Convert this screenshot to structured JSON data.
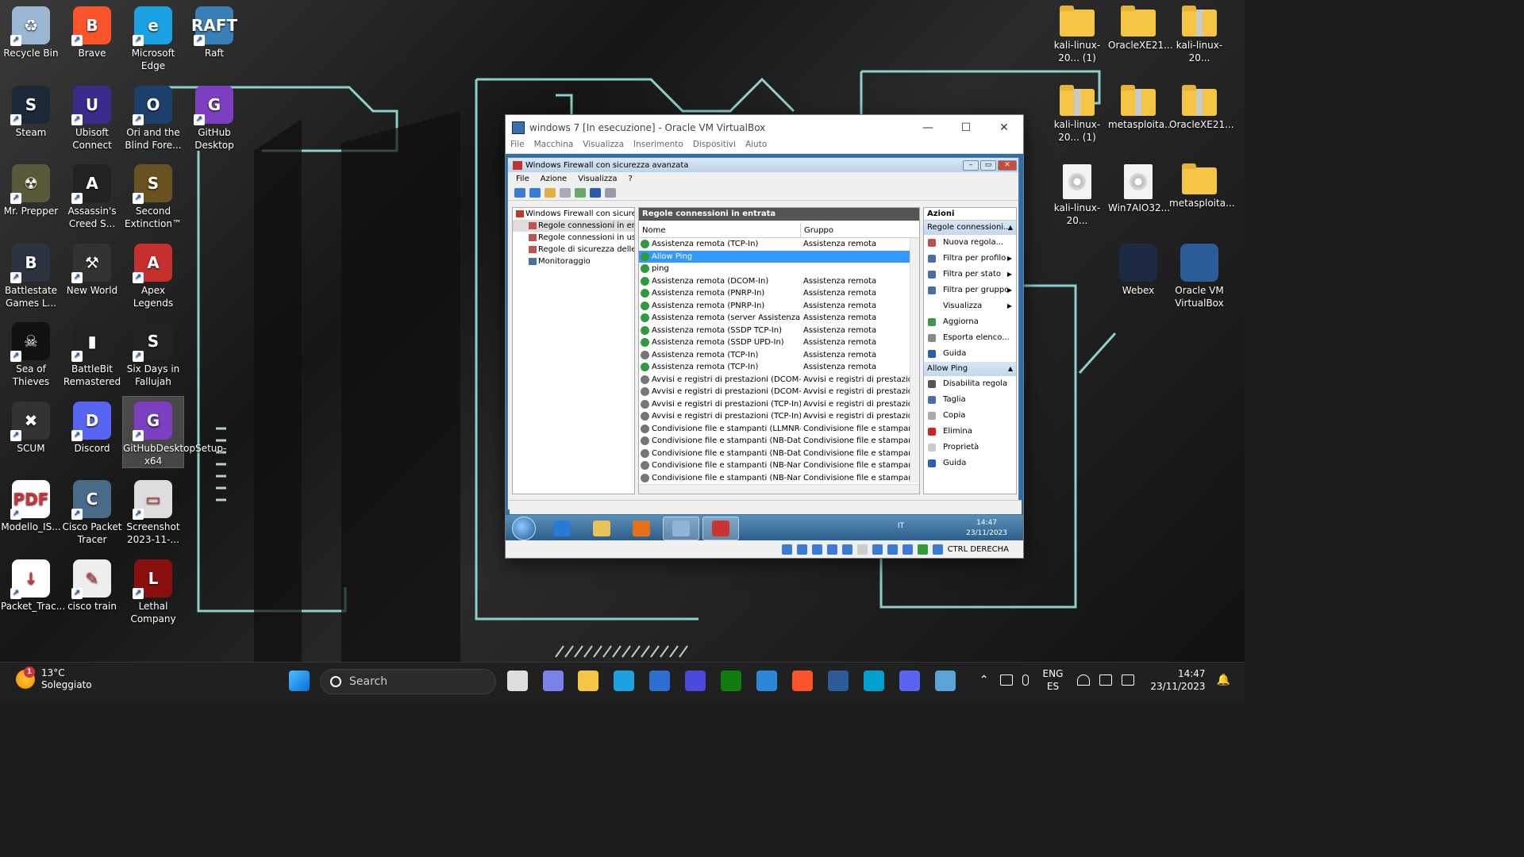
{
  "desktop": {
    "icons_left": [
      {
        "label": "Recycle Bin",
        "color": "#9bb7d4",
        "glyph": "♻"
      },
      {
        "label": "Brave",
        "color": "#fb542b",
        "glyph": "B"
      },
      {
        "label": "Microsoft Edge",
        "color": "#1ba1e2",
        "glyph": "e"
      },
      {
        "label": "Raft",
        "color": "#3a7fb8",
        "glyph": "RAFT"
      },
      {
        "label": "Steam",
        "color": "#1b2838",
        "glyph": "S"
      },
      {
        "label": "Ubisoft Connect",
        "color": "#3b2a8a",
        "glyph": "U"
      },
      {
        "label": "Ori and the Blind Fore...",
        "color": "#1d3f6b",
        "glyph": "O"
      },
      {
        "label": "GitHub Desktop",
        "color": "#7b3fbf",
        "glyph": "G"
      },
      {
        "label": "Mr. Prepper",
        "color": "#5a5a3a",
        "glyph": "☢"
      },
      {
        "label": "Assassin's Creed S...",
        "color": "#222",
        "glyph": "A"
      },
      {
        "label": "Second Extinction™",
        "color": "#6a5220",
        "glyph": "S"
      },
      {
        "label": "Battlestate Games L...",
        "color": "#2b3440",
        "glyph": "B"
      },
      {
        "label": "New World",
        "color": "#333",
        "glyph": "⚒"
      },
      {
        "label": "Apex Legends",
        "color": "#c5302e",
        "glyph": "A"
      },
      {
        "label": "Sea of Thieves",
        "color": "#111",
        "glyph": "☠"
      },
      {
        "label": "BattleBit Remastered",
        "color": "#222",
        "glyph": "▮"
      },
      {
        "label": "Six Days in Fallujah",
        "color": "#222",
        "glyph": "S"
      },
      {
        "label": "SCUM",
        "color": "#333",
        "glyph": "✖"
      },
      {
        "label": "Discord",
        "color": "#5865f2",
        "glyph": "D"
      },
      {
        "label": "GitHubDesktopSetup-x64",
        "color": "#7b3fbf",
        "glyph": "G"
      },
      {
        "label": "Modello_IS...",
        "color": "#fff",
        "glyph": "PDF"
      },
      {
        "label": "Cisco Packet Tracer",
        "color": "#4a6a8a",
        "glyph": "C"
      },
      {
        "label": "Screenshot 2023-11-...",
        "color": "#ddd",
        "glyph": "▭"
      },
      {
        "label": "Packet_Trac...",
        "color": "#fff",
        "glyph": "↓"
      },
      {
        "label": "cisco train",
        "color": "#eee",
        "glyph": "✎"
      },
      {
        "label": "Lethal Company",
        "color": "#8a1010",
        "glyph": "L"
      }
    ],
    "icons_right": [
      {
        "label": "kali-linux-20... (1)",
        "type": "folder"
      },
      {
        "label": "OracleXE21...",
        "type": "folder"
      },
      {
        "label": "kali-linux-20...",
        "type": "zip"
      },
      {
        "label": "kali-linux-20... (1)",
        "type": "zip"
      },
      {
        "label": "metasploita...",
        "type": "zip"
      },
      {
        "label": "OracleXE21...",
        "type": "zip"
      },
      {
        "label": "kali-linux-20...",
        "type": "disc"
      },
      {
        "label": "Win7AIO32...",
        "type": "disc"
      },
      {
        "label": "metasploita...",
        "type": "folder"
      },
      {
        "label": "Webex",
        "type": "app",
        "color": "#1c2a44"
      },
      {
        "label": "Oracle VM VirtualBox",
        "type": "app",
        "color": "#2a5c9a"
      }
    ]
  },
  "vbox": {
    "title": "windows 7 [In esecuzione] - Oracle VM VirtualBox",
    "menu": [
      "File",
      "Macchina",
      "Visualizza",
      "Inserimento",
      "Dispositivi",
      "Aiuto"
    ],
    "minimize": "—",
    "maximize": "☐",
    "close": "✕",
    "host_key": "CTRL DERECHA"
  },
  "firewall": {
    "title": "Windows Firewall con sicurezza avanzata",
    "menu": [
      "File",
      "Azione",
      "Visualizza",
      "?"
    ],
    "tree": [
      {
        "label": "Windows Firewall con sicurezza",
        "indent": 0
      },
      {
        "label": "Regole connessioni in entrata",
        "indent": 1,
        "selected": true
      },
      {
        "label": "Regole connessioni in uscita",
        "indent": 1
      },
      {
        "label": "Regole di sicurezza delle connessioni",
        "indent": 1
      },
      {
        "label": "Monitoraggio",
        "indent": 1
      }
    ],
    "panel_title": "Regole connessioni in entrata",
    "col_name": "Nome",
    "col_group": "Gruppo",
    "rows": [
      {
        "name": "Assistenza remota (TCP-In)",
        "group": "Assistenza remota",
        "enabled": true
      },
      {
        "name": "Allow Ping",
        "group": "",
        "enabled": true,
        "selected": true
      },
      {
        "name": "ping",
        "group": "",
        "enabled": true
      },
      {
        "name": "Assistenza remota (DCOM-In)",
        "group": "Assistenza remota",
        "enabled": true
      },
      {
        "name": "Assistenza remota (PNRP-In)",
        "group": "Assistenza remota",
        "enabled": true
      },
      {
        "name": "Assistenza remota (PNRP-In)",
        "group": "Assistenza remota",
        "enabled": true
      },
      {
        "name": "Assistenza remota (server Assistenza rem...",
        "group": "Assistenza remota",
        "enabled": true
      },
      {
        "name": "Assistenza remota (SSDP TCP-In)",
        "group": "Assistenza remota",
        "enabled": true
      },
      {
        "name": "Assistenza remota (SSDP UPD-In)",
        "group": "Assistenza remota",
        "enabled": true
      },
      {
        "name": "Assistenza remota (TCP-In)",
        "group": "Assistenza remota",
        "enabled": false
      },
      {
        "name": "Assistenza remota (TCP-In)",
        "group": "Assistenza remota",
        "enabled": true
      },
      {
        "name": "Avvisi e registri di prestazioni (DCOM-In)",
        "group": "Avvisi e registri di prestazioni",
        "enabled": false
      },
      {
        "name": "Avvisi e registri di prestazioni (DCOM-In)",
        "group": "Avvisi e registri di prestazioni",
        "enabled": false
      },
      {
        "name": "Avvisi e registri di prestazioni (TCP-In)",
        "group": "Avvisi e registri di prestazioni",
        "enabled": false
      },
      {
        "name": "Avvisi e registri di prestazioni (TCP-In)",
        "group": "Avvisi e registri di prestazioni",
        "enabled": false
      },
      {
        "name": "Condivisione file e stampanti (LLMNR-U...",
        "group": "Condivisione file e stampanti",
        "enabled": false
      },
      {
        "name": "Condivisione file e stampanti (NB-Datagr...",
        "group": "Condivisione file e stampanti",
        "enabled": false
      },
      {
        "name": "Condivisione file e stampanti (NB-Datagr...",
        "group": "Condivisione file e stampanti",
        "enabled": false
      },
      {
        "name": "Condivisione file e stampanti (NB-Name...",
        "group": "Condivisione file e stampanti",
        "enabled": false
      },
      {
        "name": "Condivisione file e stampanti (NB-Name...",
        "group": "Condivisione file e stampanti",
        "enabled": false
      }
    ],
    "actions_title": "Azioni",
    "section1": "Regole connessioni...",
    "actions1": [
      {
        "label": "Nuova regola...",
        "color": "#c0504d",
        "sub": false
      },
      {
        "label": "Filtra per profilo",
        "color": "#4a6fa5",
        "sub": true
      },
      {
        "label": "Filtra per stato",
        "color": "#4a6fa5",
        "sub": true
      },
      {
        "label": "Filtra per gruppo",
        "color": "#4a6fa5",
        "sub": true
      },
      {
        "label": "Visualizza",
        "color": "transparent",
        "sub": true
      },
      {
        "label": "Aggiorna",
        "color": "#3c9a4a",
        "sub": false
      },
      {
        "label": "Esporta elenco...",
        "color": "#888",
        "sub": false
      },
      {
        "label": "Guida",
        "color": "#2a5db0",
        "sub": false
      }
    ],
    "section2": "Allow Ping",
    "actions2": [
      {
        "label": "Disabilita regola",
        "color": "#555"
      },
      {
        "label": "Taglia",
        "color": "#4a6fa5"
      },
      {
        "label": "Copia",
        "color": "#aaa"
      },
      {
        "label": "Elimina",
        "color": "#d12020"
      },
      {
        "label": "Proprietà",
        "color": "#ccc"
      },
      {
        "label": "Guida",
        "color": "#2a5db0"
      }
    ]
  },
  "guest_taskbar": {
    "lang": "IT",
    "time": "14:47",
    "date": "23/11/2023"
  },
  "taskbar": {
    "weather_temp": "13°C",
    "weather_desc": "Soleggiato",
    "weather_badge": "1",
    "search_placeholder": "Search",
    "lang": "ENG",
    "region": "ES",
    "time": "14:47",
    "date": "23/11/2023",
    "apps": [
      {
        "name": "start-button",
        "color": "#3b8ee8"
      },
      {
        "name": "task-view",
        "color": "#ddd"
      },
      {
        "name": "teams-chat",
        "color": "#7b83eb"
      },
      {
        "name": "file-explorer",
        "color": "#f6c544"
      },
      {
        "name": "edge",
        "color": "#1ba1e2"
      },
      {
        "name": "microsoft-store",
        "color": "#2c6fd1"
      },
      {
        "name": "vs-app",
        "color": "#4a4adf"
      },
      {
        "name": "xbox",
        "color": "#107c10"
      },
      {
        "name": "mail",
        "color": "#2b88d8"
      },
      {
        "name": "brave",
        "color": "#fb542b"
      },
      {
        "name": "virtualbox",
        "color": "#2a5c9a"
      },
      {
        "name": "webex",
        "color": "#00a0d1"
      },
      {
        "name": "discord",
        "color": "#5865f2"
      },
      {
        "name": "windows7-vm",
        "color": "#5aa3d6"
      }
    ]
  }
}
